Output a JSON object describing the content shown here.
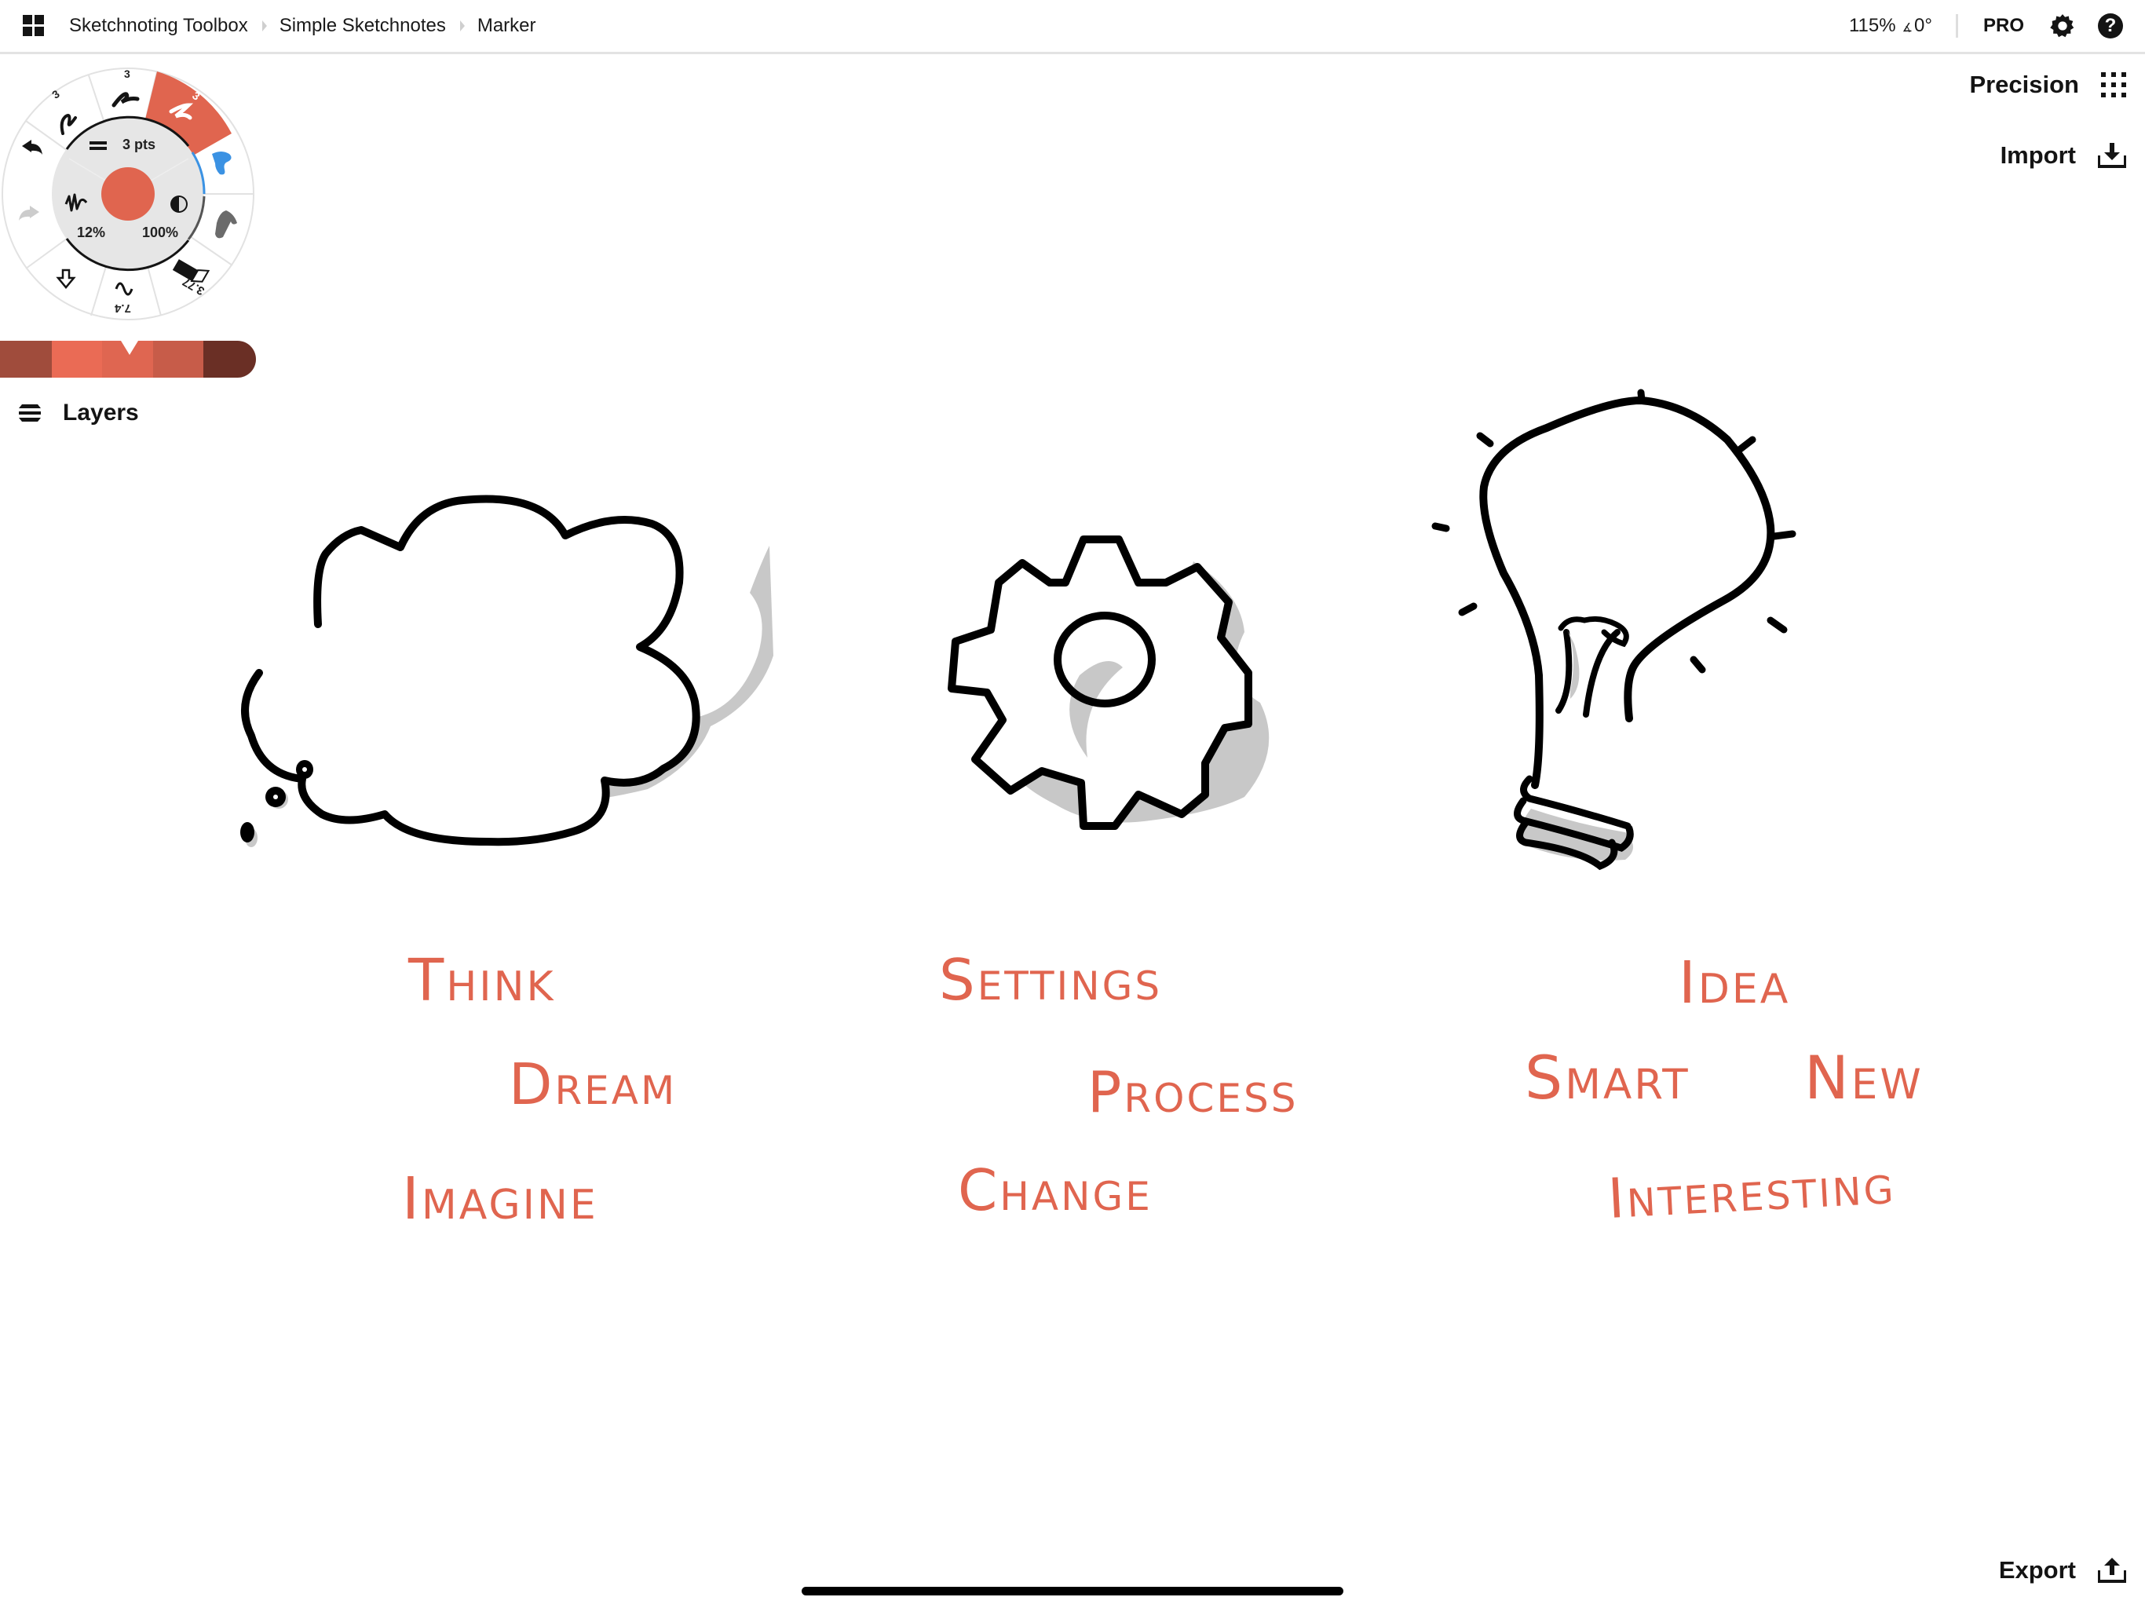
{
  "topbar": {
    "apps_icon": "grid-icon",
    "breadcrumbs": [
      "Sketchnoting Toolbox",
      "Simple Sketchnotes",
      "Marker"
    ],
    "zoom_level": "115%",
    "rotation_symbol": "∡",
    "rotation": "0°",
    "pro_label": "PRO",
    "settings_icon": "gear-icon",
    "help_icon": "question-icon",
    "help_glyph": "?"
  },
  "tool_wheel": {
    "size_label": "3 pts",
    "smoothing_label": "12%",
    "opacity_label": "100%",
    "current_color": "#e0654f",
    "tools": [
      {
        "name": "pencil",
        "size": "3",
        "selected": false
      },
      {
        "name": "pen",
        "size": "3",
        "selected": false
      },
      {
        "name": "marker",
        "size": "3",
        "selected": true
      },
      {
        "name": "brush-blue",
        "selected": false
      },
      {
        "name": "brush-gray",
        "selected": false
      },
      {
        "name": "eraser",
        "value": "3.77",
        "selected": false
      },
      {
        "name": "smooth",
        "value": "7.4",
        "selected": false
      },
      {
        "name": "fill",
        "selected": false
      }
    ],
    "pencil_size": "3",
    "pen_size": "3",
    "marker_size": "3",
    "eraser_value": "3.77",
    "smooth_value": "7.4",
    "undo_icon": "undo-icon",
    "redo_icon": "redo-icon"
  },
  "color_strip": {
    "swatches": [
      "#a04c3c",
      "#ea6b55",
      "#df6651",
      "#c75c49",
      "#6a2f25"
    ],
    "selected_index": 2
  },
  "layers": {
    "label": "Layers",
    "icon": "layers-icon"
  },
  "actions": {
    "precision_label": "Precision",
    "import_label": "Import",
    "export_label": "Export"
  },
  "canvas": {
    "ink_color": "#e0654f",
    "shadow_color": "#c8c8c8",
    "drawings": [
      "thought-cloud",
      "gear",
      "light-bulb"
    ],
    "words": {
      "think": "Think",
      "dream": "Dream",
      "imagine": "Imagine",
      "settings": "Settings",
      "process": "Process",
      "change": "Change",
      "idea": "Idea",
      "smart": "Smart",
      "new": "New",
      "interesting": "Interesting"
    }
  }
}
